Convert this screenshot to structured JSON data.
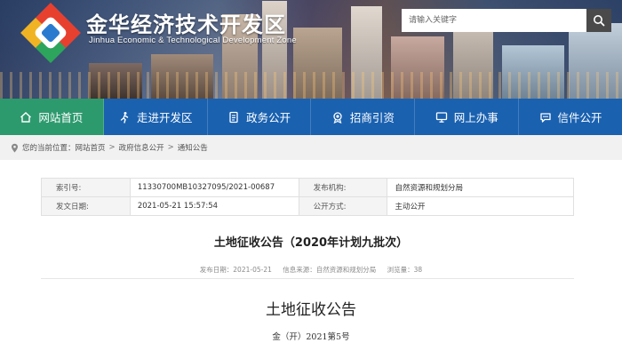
{
  "header": {
    "site_title": "金华经济技术开发区",
    "site_subtitle": "Jinhua Economic & Technological Development Zone",
    "search_placeholder": "请输入关键字"
  },
  "nav": {
    "items": [
      {
        "label": "网站首页",
        "icon": "home-icon",
        "active": true
      },
      {
        "label": "走进开发区",
        "icon": "walk-icon",
        "active": false
      },
      {
        "label": "政务公开",
        "icon": "document-icon",
        "active": false
      },
      {
        "label": "招商引资",
        "icon": "medal-icon",
        "active": false
      },
      {
        "label": "网上办事",
        "icon": "monitor-icon",
        "active": false
      },
      {
        "label": "信件公开",
        "icon": "chat-icon",
        "active": false
      }
    ]
  },
  "breadcrumb": {
    "prefix": "您的当前位置：",
    "items": [
      "网站首页",
      "政府信息公开",
      "通知公告"
    ],
    "separator": ">"
  },
  "info": {
    "index_label": "索引号:",
    "index_value": "11330700MB10327095/2021-00687",
    "publisher_label": "发布机构:",
    "publisher_value": "自然资源和规划分局",
    "date_label": "发文日期:",
    "date_value": "2021-05-21 15:57:54",
    "method_label": "公开方式:",
    "method_value": "主动公开"
  },
  "article": {
    "title": "土地征收公告（2020年计划九批次）",
    "meta_date": "发布日期：2021-05-21",
    "meta_source": "信息来源：自然资源和规划分局",
    "meta_views": "浏览量：38",
    "body_title": "土地征收公告",
    "body_docno": "金（开）2021第5号"
  },
  "colors": {
    "nav_blue": "#1a61b0",
    "nav_active_green": "#2d9a6e",
    "search_button": "#4a4a4a"
  }
}
